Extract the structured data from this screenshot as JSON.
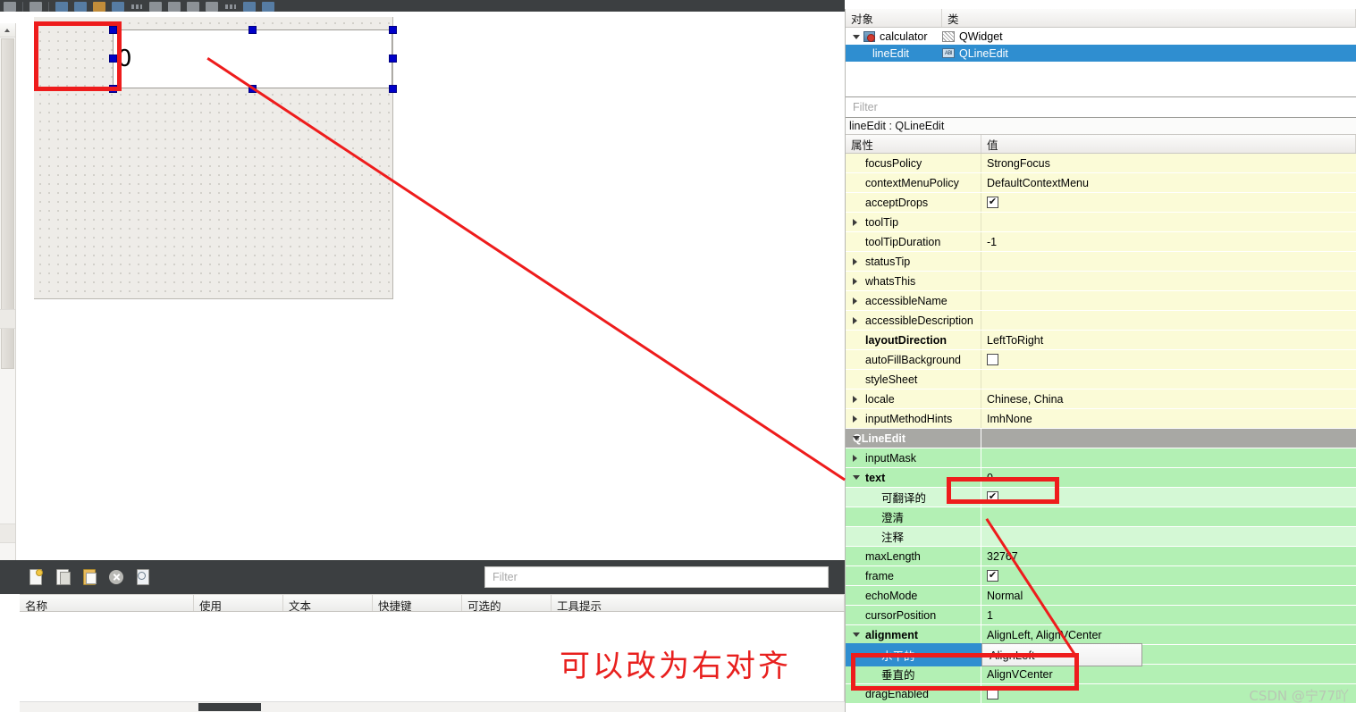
{
  "toolbar": {
    "icons": [
      "undo-icon",
      "redo-icon",
      "separator",
      "close-icon",
      "edit-widgets-icon",
      "edit-signals-icon",
      "edit-buddies-icon",
      "edit-tab-order-icon",
      "layout-horizontal-icon",
      "layout-vertical-icon",
      "layout-splitter-h-icon",
      "layout-splitter-v-icon",
      "layout-grid-icon",
      "layout-form-icon",
      "break-layout-icon",
      "adjust-size-icon"
    ]
  },
  "canvas": {
    "form_name": "calculator",
    "line_edit_text": "0",
    "annotation": "可以改为右对齐"
  },
  "watermark": "CSDN @宁77吖",
  "action_editor": {
    "toolbar_icons": [
      "new-action-icon",
      "copy-action-icon",
      "paste-action-icon",
      "delete-action-icon",
      "navigate-action-icon"
    ],
    "filter_placeholder": "Filter",
    "filter_value": "",
    "columns": [
      "名称",
      "使用",
      "文本",
      "快捷键",
      "可选的",
      "工具提示"
    ],
    "rows": []
  },
  "object_inspector": {
    "columns": [
      "对象",
      "类"
    ],
    "filter_placeholder": "Filter",
    "filter_value": "",
    "items": [
      {
        "object": "calculator",
        "class": "QWidget",
        "icon": "widget-icon",
        "class_icon": "hatch-icon",
        "selected": false,
        "level": 0,
        "expanded": true
      },
      {
        "object": "lineEdit",
        "class": "QLineEdit",
        "icon": "",
        "class_icon": "lineedit-icon",
        "selected": true,
        "level": 1,
        "expanded": false
      }
    ]
  },
  "property_editor": {
    "title": "lineEdit : QLineEdit",
    "columns": [
      "属性",
      "值"
    ],
    "rows": [
      {
        "name": "focusPolicy",
        "value": "StrongFocus",
        "style": "yellow",
        "indent": 1,
        "expander": "none",
        "bold": false,
        "type": "text"
      },
      {
        "name": "contextMenuPolicy",
        "value": "DefaultContextMenu",
        "style": "yellow",
        "indent": 1,
        "expander": "none",
        "bold": false,
        "type": "text"
      },
      {
        "name": "acceptDrops",
        "value": "✔",
        "style": "yellow",
        "indent": 1,
        "expander": "none",
        "bold": false,
        "type": "check"
      },
      {
        "name": "toolTip",
        "value": "",
        "style": "yellow",
        "indent": 1,
        "expander": "right",
        "bold": false,
        "type": "text"
      },
      {
        "name": "toolTipDuration",
        "value": "-1",
        "style": "yellow",
        "indent": 1,
        "expander": "none",
        "bold": false,
        "type": "text"
      },
      {
        "name": "statusTip",
        "value": "",
        "style": "yellow",
        "indent": 1,
        "expander": "right",
        "bold": false,
        "type": "text"
      },
      {
        "name": "whatsThis",
        "value": "",
        "style": "yellow",
        "indent": 1,
        "expander": "right",
        "bold": false,
        "type": "text"
      },
      {
        "name": "accessibleName",
        "value": "",
        "style": "yellow",
        "indent": 1,
        "expander": "right",
        "bold": false,
        "type": "text"
      },
      {
        "name": "accessibleDescription",
        "value": "",
        "style": "yellow",
        "indent": 1,
        "expander": "right",
        "bold": false,
        "type": "text"
      },
      {
        "name": "layoutDirection",
        "value": "LeftToRight",
        "style": "yellow",
        "indent": 1,
        "expander": "none",
        "bold": true,
        "type": "text"
      },
      {
        "name": "autoFillBackground",
        "value": "",
        "style": "yellow",
        "indent": 1,
        "expander": "none",
        "bold": false,
        "type": "uncheck"
      },
      {
        "name": "styleSheet",
        "value": "",
        "style": "yellow",
        "indent": 1,
        "expander": "none",
        "bold": false,
        "type": "text"
      },
      {
        "name": "locale",
        "value": "Chinese, China",
        "style": "yellow",
        "indent": 1,
        "expander": "right",
        "bold": false,
        "type": "text"
      },
      {
        "name": "inputMethodHints",
        "value": "ImhNone",
        "style": "yellow",
        "indent": 1,
        "expander": "right",
        "bold": false,
        "type": "text"
      },
      {
        "name": "QLineEdit",
        "value": "",
        "style": "group",
        "indent": 0,
        "expander": "down",
        "bold": true,
        "type": "text"
      },
      {
        "name": "inputMask",
        "value": "",
        "style": "green",
        "indent": 1,
        "expander": "right",
        "bold": false,
        "type": "text"
      },
      {
        "name": "text",
        "value": "0",
        "style": "green",
        "indent": 1,
        "expander": "down",
        "bold": true,
        "type": "text"
      },
      {
        "name": "可翻译的",
        "value": "✔",
        "style": "green2",
        "indent": 2,
        "expander": "none",
        "bold": false,
        "type": "check"
      },
      {
        "name": "澄清",
        "value": "",
        "style": "green",
        "indent": 2,
        "expander": "none",
        "bold": false,
        "type": "text"
      },
      {
        "name": "注释",
        "value": "",
        "style": "green2",
        "indent": 2,
        "expander": "none",
        "bold": false,
        "type": "text"
      },
      {
        "name": "maxLength",
        "value": "32767",
        "style": "green",
        "indent": 1,
        "expander": "none",
        "bold": false,
        "type": "text"
      },
      {
        "name": "frame",
        "value": "✔",
        "style": "green",
        "indent": 1,
        "expander": "none",
        "bold": false,
        "type": "check"
      },
      {
        "name": "echoMode",
        "value": "Normal",
        "style": "green",
        "indent": 1,
        "expander": "none",
        "bold": false,
        "type": "text"
      },
      {
        "name": "cursorPosition",
        "value": "1",
        "style": "green",
        "indent": 1,
        "expander": "none",
        "bold": false,
        "type": "text"
      },
      {
        "name": "alignment",
        "value": "AlignLeft, AlignVCenter",
        "style": "green",
        "indent": 1,
        "expander": "down",
        "bold": true,
        "type": "text"
      },
      {
        "name": "水平的",
        "value": "AlignLeft",
        "style": "green",
        "indent": 2,
        "expander": "none",
        "bold": false,
        "type": "text"
      },
      {
        "name": "垂直的",
        "value": "AlignVCenter",
        "style": "green",
        "indent": 2,
        "expander": "none",
        "bold": false,
        "type": "text"
      },
      {
        "name": "dragEnabled",
        "value": "",
        "style": "green",
        "indent": 1,
        "expander": "none",
        "bold": false,
        "type": "uncheck"
      }
    ],
    "editing_row": {
      "label": "水平的",
      "value": "AlignLeft"
    }
  },
  "colors": {
    "selection_blue": "#2f8ed0",
    "annotation_red": "#ee1c1c",
    "group_gray": "#a8a8a4",
    "row_yellow": "#fbfbd7",
    "row_green": "#b3f0b4"
  }
}
